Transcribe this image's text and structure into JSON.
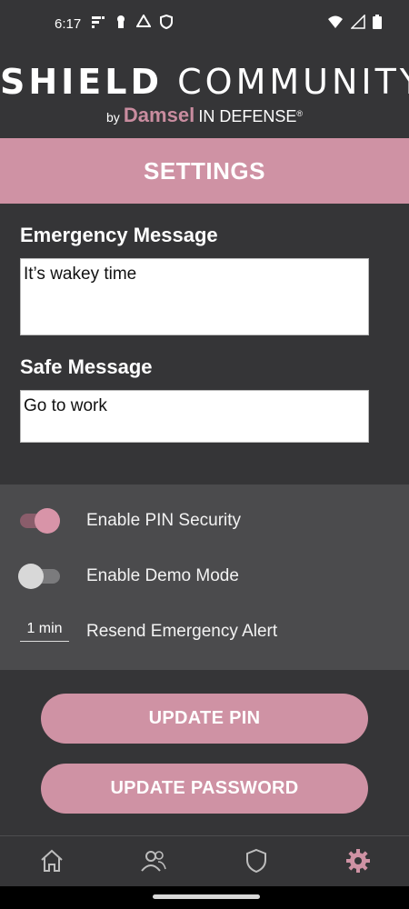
{
  "status_bar": {
    "time": "6:17",
    "icons": [
      "notification-icon",
      "keyhole-icon",
      "recycle-icon",
      "shield-status-icon"
    ],
    "right_icons": [
      "wifi-icon",
      "signal-icon",
      "battery-icon"
    ]
  },
  "logo": {
    "title_bold": "SHIELD",
    "title_thin": "COMMUNITY",
    "by": "by",
    "brand": "Damsel",
    "defense": "IN DEFENSE",
    "reg": "®"
  },
  "header": {
    "title": "SETTINGS"
  },
  "emergency": {
    "label": "Emergency Message",
    "value": "It’s wakey time"
  },
  "safe": {
    "label": "Safe Message",
    "value": "Go to work"
  },
  "options": {
    "pin_security": {
      "label": "Enable PIN Security",
      "enabled": true
    },
    "demo_mode": {
      "label": "Enable Demo Mode",
      "enabled": false
    },
    "resend": {
      "label": "Resend Emergency Alert",
      "interval": "1 min"
    }
  },
  "buttons": {
    "update_pin": "UPDATE PIN",
    "update_password": "UPDATE PASSWORD"
  },
  "nav": {
    "items": [
      "home-icon",
      "community-icon",
      "shield-icon",
      "settings-gear-icon"
    ],
    "active": "settings-gear-icon"
  },
  "colors": {
    "accent": "#cf92a4",
    "background": "#353537",
    "options_panel": "#4b4b4d"
  }
}
